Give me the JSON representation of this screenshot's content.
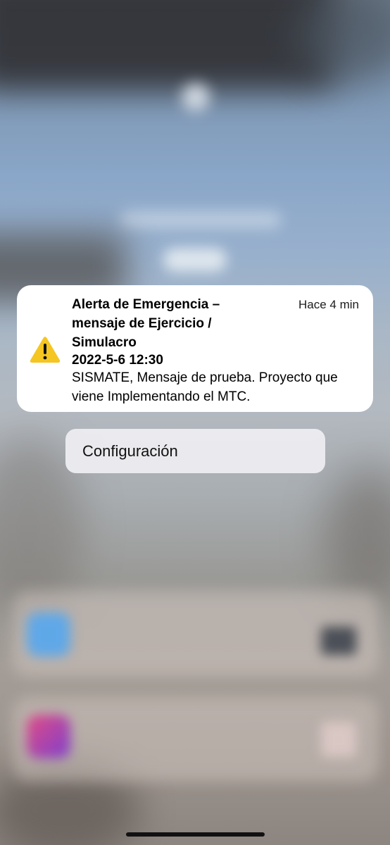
{
  "notification": {
    "title": "Alerta de Emergencia – mensaje de Ejercicio / Simulacro",
    "time": "Hace 4 min",
    "datetime": "2022-5-6 12:30",
    "body": "SISMATE, Mensaje de prueba. Proyecto que viene Implementando el MTC.",
    "icon": "warning-icon",
    "icon_color": "#f5c521"
  },
  "menu": {
    "config_label": "Configuración"
  }
}
